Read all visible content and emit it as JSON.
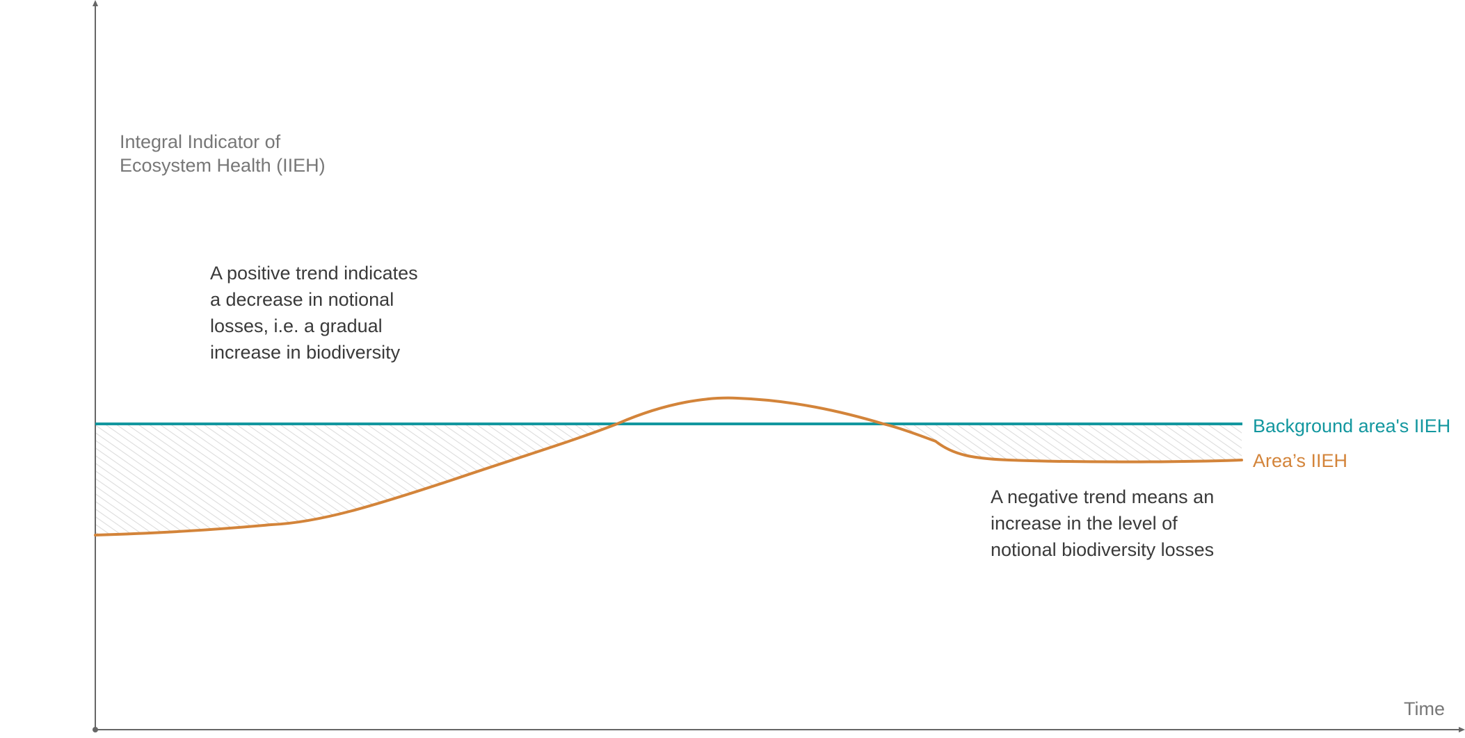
{
  "y_axis_label": [
    "Integral Indicator of",
    "Ecosystem Health (IIEH)"
  ],
  "x_axis_label": "Time",
  "positive_note": [
    "A positive trend indicates",
    "a decrease in notional",
    "losses, i.e. a gradual",
    "increase in biodiversity"
  ],
  "negative_note": [
    "A negative trend means an",
    "increase in the level of",
    "notional biodiversity losses"
  ],
  "series": {
    "background": {
      "name": "Background area's IIEH",
      "color": "#13979f"
    },
    "area": {
      "name": "Area’s IIEH",
      "color": "#d3843a"
    }
  },
  "colors": {
    "axis": "#666666",
    "hatch": "#dcdcdc"
  }
}
